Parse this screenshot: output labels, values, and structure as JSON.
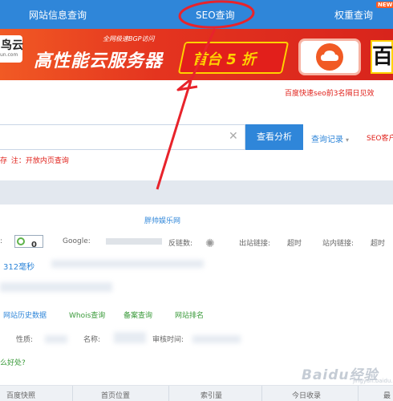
{
  "top_nav": {
    "items": [
      "网站信息查询",
      "SEO查询",
      "权重查询"
    ],
    "new_badge": "NEW",
    "active_index": 1
  },
  "banner": {
    "logo_text": "鸟云",
    "logo_url": "un.com",
    "small_tag": "全网极速BGP访问",
    "headline": "高性能云服务器",
    "promo": "首台 5 折",
    "right_char": "百"
  },
  "ad_link": "百度快速seo前3名隔日见效",
  "search": {
    "button_label": "查看分析",
    "history_label": "查询记录",
    "client_label": "SEO客户"
  },
  "note": {
    "prefix": "存",
    "tag": "注：",
    "text": "开放内页查询"
  },
  "site_title": "胖帅娱乐网",
  "metrics": {
    "pr_value": "0",
    "google_label": "Google:",
    "backlinks_label": "反链数:",
    "outbound_label": "出站链接:",
    "outbound_value": "超时",
    "internal_label": "站内链接:",
    "internal_value": "超时"
  },
  "speed_value": "312毫秒",
  "links": [
    "网站历史数据",
    "Whois查询",
    "备案查询",
    "网站排名"
  ],
  "info": {
    "nature_label": "性质:",
    "name_label": "名称:",
    "review_label": "审核时间:"
  },
  "faq_link": "么好处?",
  "bottom_tabs": [
    "百度快照",
    "首页位置",
    "索引量",
    "今日收录",
    "最"
  ],
  "watermark": {
    "text": "Baidu经验",
    "sub": "jingyan.baidu.com"
  },
  "colors": {
    "nav_blue": "#2f86d9",
    "accent_red": "#e0201a",
    "annotation_red": "#e8232b"
  }
}
